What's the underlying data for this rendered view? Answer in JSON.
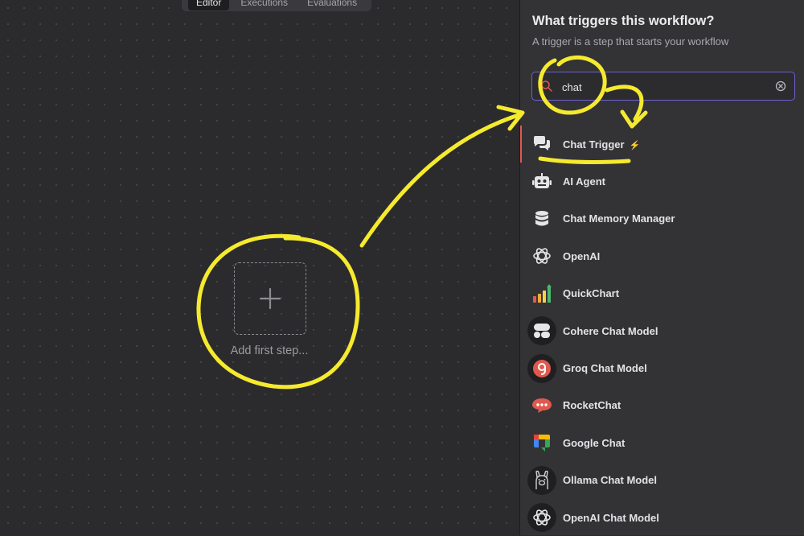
{
  "tabs": [
    {
      "label": "Editor",
      "active": true
    },
    {
      "label": "Executions",
      "active": false
    },
    {
      "label": "Evaluations",
      "active": false
    }
  ],
  "canvas": {
    "add_step_label": "Add first step..."
  },
  "panel": {
    "title": "What triggers this workflow?",
    "subtitle": "A trigger is a step that starts your workflow",
    "search": {
      "value": "chat"
    },
    "nodes": [
      {
        "label": "Chat Trigger",
        "icon": "chat-bubbles-icon",
        "trigger_badge": "⚡",
        "selected": true
      },
      {
        "label": "AI Agent",
        "icon": "robot-icon"
      },
      {
        "label": "Chat Memory Manager",
        "icon": "database-icon"
      },
      {
        "label": "OpenAI",
        "icon": "openai-icon"
      },
      {
        "label": "QuickChart",
        "icon": "bar-chart-icon"
      },
      {
        "label": "Cohere Chat Model",
        "icon": "cohere-icon"
      },
      {
        "label": "Groq Chat Model",
        "icon": "groq-icon"
      },
      {
        "label": "RocketChat",
        "icon": "rocketchat-icon"
      },
      {
        "label": "Google Chat",
        "icon": "google-chat-icon"
      },
      {
        "label": "Ollama Chat Model",
        "icon": "ollama-icon"
      },
      {
        "label": "OpenAI Chat Model",
        "icon": "openai-icon"
      }
    ]
  },
  "colors": {
    "accent": "#6f5fd0",
    "selection": "#e0594e",
    "annotation": "#f5ea2e"
  }
}
